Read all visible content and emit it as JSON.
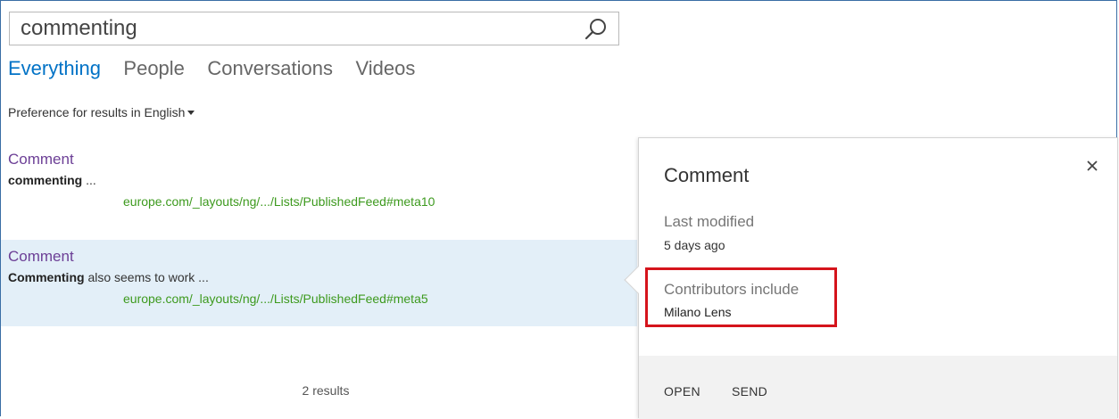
{
  "search": {
    "value": "commenting"
  },
  "tabs": [
    {
      "label": "Everything",
      "active": true
    },
    {
      "label": "People",
      "active": false
    },
    {
      "label": "Conversations",
      "active": false
    },
    {
      "label": "Videos",
      "active": false
    }
  ],
  "preference": {
    "prefix": "Preference for results in ",
    "language": "English"
  },
  "results": [
    {
      "title": "Comment",
      "snippet_bold": "commenting",
      "snippet_rest": " ...",
      "url": "europe.com/_layouts/ng/.../Lists/PublishedFeed#meta10"
    },
    {
      "title": "Comment",
      "snippet_bold": "Commenting",
      "snippet_rest": " also seems to work ...",
      "url": "europe.com/_layouts/ng/.../Lists/PublishedFeed#meta5"
    }
  ],
  "result_count": "2 results",
  "callout": {
    "title": "Comment",
    "last_modified_label": "Last modified",
    "last_modified_value": "5 days ago",
    "contributors_label": "Contributors include",
    "contributors_value": "Milano Lens",
    "actions": {
      "open": "OPEN",
      "send": "SEND"
    }
  },
  "colors": {
    "active_tab": "#0072c6",
    "result_title": "#6c3f96",
    "result_url": "#3d9a1e",
    "selected_row_bg": "#e3eff8",
    "highlight_box": "#d5141c"
  },
  "icons": {
    "search": "search-icon",
    "close": "close-icon",
    "dropdown": "caret-down-icon"
  }
}
